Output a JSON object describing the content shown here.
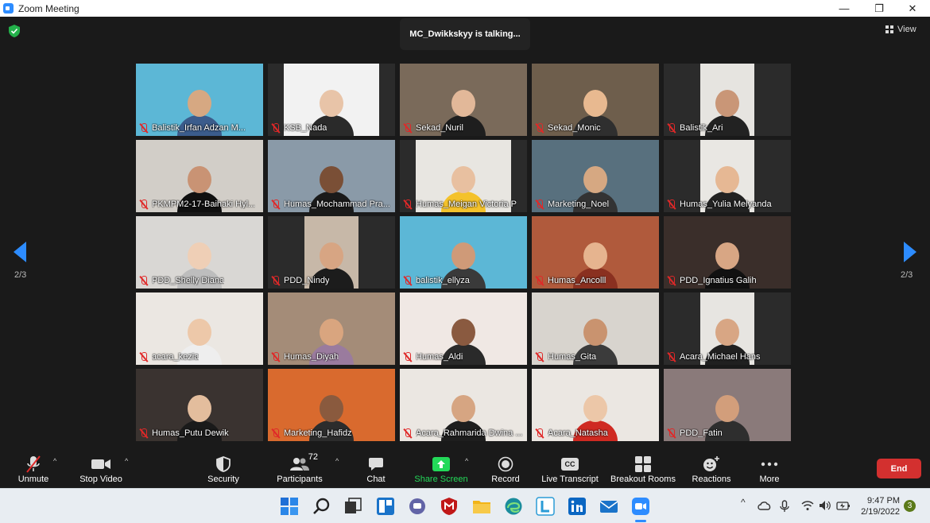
{
  "window": {
    "title": "Zoom Meeting",
    "minimize": "—",
    "maximize": "❐",
    "close": "✕"
  },
  "meeting": {
    "talking": "MC_Dwikkskyy is talking...",
    "view_label": "View",
    "page_indicator_left": "2/3",
    "page_indicator_right": "2/3",
    "participants": [
      {
        "name": "Balistik_Irfan Adzan M...",
        "bg": "#5cb7d6",
        "skin": "#d6a882",
        "shirt": "#3b5c8c",
        "width": "full"
      },
      {
        "name": "KSB_Nada",
        "bg": "#f2f2f2",
        "skin": "#e8c4a8",
        "shirt": "#2a2a2a",
        "width": "mid"
      },
      {
        "name": "Sekad_Nuril",
        "bg": "#7a6a5a",
        "skin": "#e2b899",
        "shirt": "#1e1e1e",
        "width": "full"
      },
      {
        "name": "Sekad_Monic",
        "bg": "#6e5e4c",
        "skin": "#e8b990",
        "shirt": "#2f2f2f",
        "width": "full"
      },
      {
        "name": "Balistik_Ari",
        "bg": "#e6e4e0",
        "skin": "#c99677",
        "shirt": "#222222",
        "width": "narrow"
      },
      {
        "name": "PKMPM2-17-Baihaki Hyl...",
        "bg": "#d2cec8",
        "skin": "#c99374",
        "shirt": "#101010",
        "width": "full"
      },
      {
        "name": "Humas_Mochammad Pra...",
        "bg": "#8a9aa8",
        "skin": "#7a4f36",
        "shirt": "#1a1a1a",
        "width": "full"
      },
      {
        "name": "Humas_Meigan Victoria P",
        "bg": "#e8e6e1",
        "skin": "#e8c0a0",
        "shirt": "#f4c22b",
        "width": "mid"
      },
      {
        "name": "Marketing_Noel",
        "bg": "#58707e",
        "skin": "#d6a882",
        "shirt": "#333333",
        "width": "full"
      },
      {
        "name": "Humas_Yulia Melyanda",
        "bg": "#e9e7e3",
        "skin": "#e6b894",
        "shirt": "#222222",
        "width": "narrow"
      },
      {
        "name": "PDD_Shelly Diana",
        "bg": "#d9d7d4",
        "skin": "#efcfb6",
        "shirt": "#bdbdbd",
        "width": "full"
      },
      {
        "name": "PDD_Nindy",
        "bg": "#c7b8a8",
        "skin": "#d7a583",
        "shirt": "#1c1c1c",
        "width": "narrow"
      },
      {
        "name": "balistik_ellyza",
        "bg": "#5cb7d6",
        "skin": "#cf9a78",
        "shirt": "#3a3a3a",
        "width": "full"
      },
      {
        "name": "Humas_Ancolll",
        "bg": "#b05a3c",
        "skin": "#e6b48f",
        "shirt": "#8a3020",
        "width": "full"
      },
      {
        "name": "PDD_Ignatius Galih",
        "bg": "#3a2e2a",
        "skin": "#d8a684",
        "shirt": "#111111",
        "width": "full"
      },
      {
        "name": "acara_kezia",
        "bg": "#ebe7e2",
        "skin": "#edc8a9",
        "shirt": "#eeeeee",
        "width": "full"
      },
      {
        "name": "Humas_Diyah",
        "bg": "#a48c78",
        "skin": "#d9a57f",
        "shirt": "#9a7b9e",
        "width": "full"
      },
      {
        "name": "Humas_Aldi",
        "bg": "#f0e8e4",
        "skin": "#8a5a40",
        "shirt": "#2a2a2a",
        "width": "full"
      },
      {
        "name": "Humas_Gita",
        "bg": "#d8d4ce",
        "skin": "#c9936f",
        "shirt": "#3b3b3b",
        "width": "full"
      },
      {
        "name": "Acara_Michael Hans",
        "bg": "#e7e5e1",
        "skin": "#d8a684",
        "shirt": "#202020",
        "width": "narrow"
      },
      {
        "name": "Humas_Putu Dewik",
        "bg": "#3a3330",
        "skin": "#e3bd9d",
        "shirt": "#1a1a1a",
        "width": "full"
      },
      {
        "name": "Marketing_Hafidz",
        "bg": "#d96a2e",
        "skin": "#8a5a3e",
        "shirt": "#2c2c2c",
        "width": "full"
      },
      {
        "name": "Acara_Rahmarida Dwina ...",
        "bg": "#ebe7e2",
        "skin": "#d6a582",
        "shirt": "#1e1e1e",
        "width": "full"
      },
      {
        "name": "Acara_Natasha",
        "bg": "#ebe7e2",
        "skin": "#ecc7a8",
        "shirt": "#cf2a22",
        "width": "full"
      },
      {
        "name": "PDD_Fatin",
        "bg": "#8a7a7a",
        "skin": "#d29e7b",
        "shirt": "#2e2e2e",
        "width": "full"
      }
    ]
  },
  "toolbar": {
    "unmute": "Unmute",
    "stop_video": "Stop Video",
    "security": "Security",
    "participants": "Participants",
    "participant_count": "72",
    "chat": "Chat",
    "share_screen": "Share Screen",
    "record": "Record",
    "live_transcript": "Live Transcript",
    "breakout_rooms": "Breakout Rooms",
    "reactions": "Reactions",
    "more": "More",
    "end": "End",
    "cc_label": "CC",
    "caret": "^",
    "share_color": "#23d959",
    "end_color": "#d3302f"
  },
  "taskbar": {
    "time": "9:47 PM",
    "date": "2/19/2022",
    "notifications": "3",
    "tray_chevron": "^"
  }
}
